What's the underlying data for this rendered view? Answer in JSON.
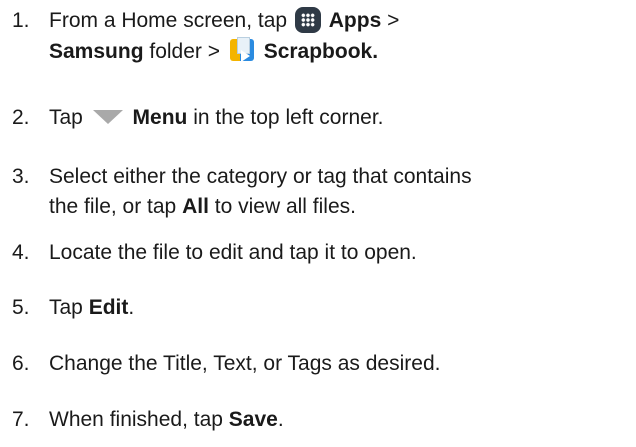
{
  "steps": [
    {
      "num": "1.",
      "line1": {
        "prefix": "From a Home screen, tap ",
        "apps": "Apps",
        "suffix": " >"
      },
      "line2": {
        "samsung": "Samsung",
        "folder": " folder > ",
        "scrapbook": "Scrapbook."
      },
      "icons": [
        "apps-grid-icon",
        "scrapbook-app-icon"
      ]
    },
    {
      "num": "2.",
      "prefix": "Tap ",
      "menu": "Menu",
      "suffix": " in the top left corner.",
      "icon": "menu-triangle-icon",
      "icon_color": "#a9a9a9"
    },
    {
      "num": "3.",
      "line1": "Select either the category or tag that contains",
      "line2_prefix": "the file, or tap ",
      "all": "All",
      "line2_suffix": " to view all files."
    },
    {
      "num": "4.",
      "text": "Locate the file to edit and tap it to open."
    },
    {
      "num": "5.",
      "prefix": "Tap ",
      "edit": "Edit",
      "suffix": "."
    },
    {
      "num": "6.",
      "text": "Change the Title, Text, or Tags as desired."
    },
    {
      "num": "7.",
      "prefix": "When finished, tap ",
      "save": "Save",
      "suffix": "."
    }
  ]
}
